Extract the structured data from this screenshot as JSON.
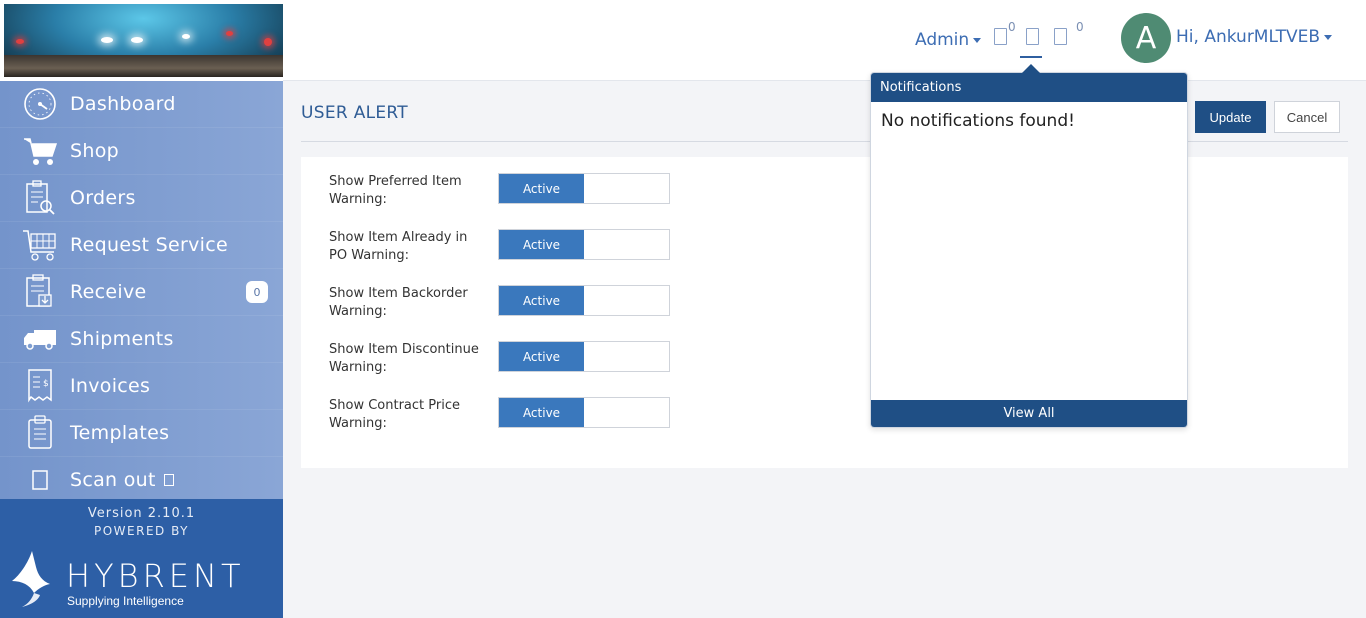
{
  "header": {
    "admin_label": "Admin",
    "icon1_count": "0",
    "icon3_count": "0",
    "avatar_letter": "A",
    "user_greeting": "Hi, AnkurMLTVEB"
  },
  "sidebar": {
    "items": [
      {
        "label": "Dashboard",
        "icon": "speedometer-icon"
      },
      {
        "label": "Shop",
        "icon": "cart-icon"
      },
      {
        "label": "Orders",
        "icon": "orders-icon"
      },
      {
        "label": "Request Service",
        "icon": "service-cart-icon"
      },
      {
        "label": "Receive",
        "icon": "receive-icon",
        "badge": "0"
      },
      {
        "label": "Shipments",
        "icon": "truck-icon"
      },
      {
        "label": "Invoices",
        "icon": "invoice-icon"
      },
      {
        "label": "Templates",
        "icon": "clipboard-icon"
      },
      {
        "label": "Scan out",
        "icon": "scan-icon"
      }
    ],
    "version": "Version 2.10.1",
    "powered_by": "POWERED BY",
    "brand_name": "HYBRENT",
    "brand_tagline": "Supplying Intelligence"
  },
  "main": {
    "title": "USER ALERT",
    "update_label": "Update",
    "cancel_label": "Cancel",
    "settings": [
      {
        "line1": "Show Preferred Item",
        "line2": "Warning:",
        "state": "Active"
      },
      {
        "line1": "Show Item Already in",
        "line2": "PO Warning:",
        "state": "Active"
      },
      {
        "line1": "Show Item Backorder",
        "line2": "Warning:",
        "state": "Active"
      },
      {
        "line1": "Show Item Discontinue",
        "line2": "Warning:",
        "state": "Active"
      },
      {
        "line1": "Show Contract Price",
        "line2": "Warning:",
        "state": "Active"
      }
    ]
  },
  "notifications": {
    "title": "Notifications",
    "empty_message": "No notifications found!",
    "view_all_label": "View All"
  },
  "colors": {
    "sidebar": "#7f9ed0",
    "primary": "#1f4f85",
    "toggle_active": "#3a78bd",
    "footer": "#2d5fa6",
    "avatar": "#4f8b73"
  }
}
